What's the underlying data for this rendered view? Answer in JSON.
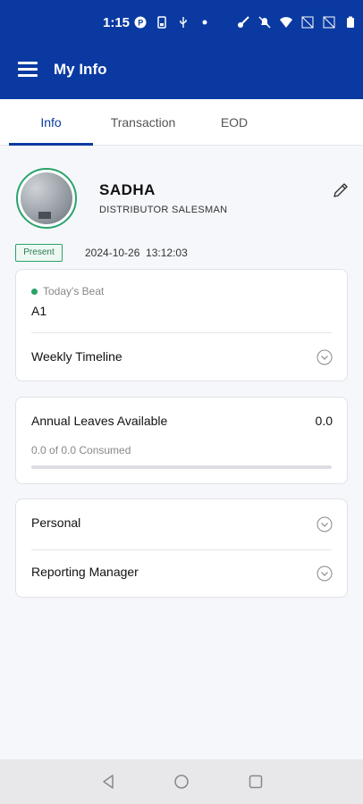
{
  "status_bar": {
    "time": "1:15",
    "icons_left": [
      "p-icon",
      "sim-icon",
      "usb-icon",
      "dot-icon"
    ],
    "icons_right": [
      "key-icon",
      "mute-icon",
      "wifi-icon",
      "no-signal-icon",
      "no-signal-icon",
      "battery-icon"
    ]
  },
  "app_bar": {
    "title": "My Info",
    "menu_icon": "menu-icon"
  },
  "tabs": [
    {
      "label": "Info",
      "active": true
    },
    {
      "label": "Transaction",
      "active": false
    },
    {
      "label": "EOD",
      "active": false
    }
  ],
  "profile": {
    "name": "SADHA",
    "role": "DISTRIBUTOR SALESMAN",
    "status_badge": "Present",
    "datetime": "2024-10-26  13:12:03",
    "edit_icon": "pencil-icon"
  },
  "beat_card": {
    "beat_label": "Today's Beat",
    "beat_value": "A1",
    "timeline_label": "Weekly Timeline"
  },
  "leave_card": {
    "label": "Annual Leaves Available",
    "value": "0.0",
    "consumed_text": "0.0 of 0.0 Consumed",
    "progress": 0
  },
  "info_card": {
    "rows": [
      {
        "label": "Personal"
      },
      {
        "label": "Reporting Manager"
      }
    ]
  },
  "colors": {
    "primary": "#0a3aa1",
    "success": "#2aa36b",
    "background": "#f6f7fb"
  }
}
